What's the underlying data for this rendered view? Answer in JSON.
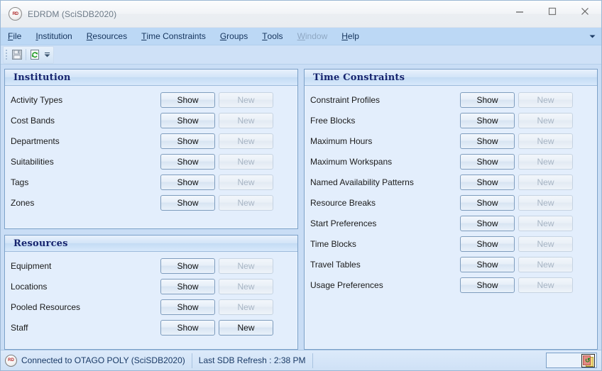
{
  "window": {
    "title": "EDRDM (SciSDB2020)",
    "app_icon": "edrdm-app-icon",
    "controls": {
      "minimize": "minimize-icon",
      "maximize": "maximize-icon",
      "close": "close-icon"
    }
  },
  "menubar": {
    "items": [
      {
        "label": "File",
        "mnemonic": "F",
        "disabled": false
      },
      {
        "label": "Institution",
        "mnemonic": "I",
        "disabled": false
      },
      {
        "label": "Resources",
        "mnemonic": "R",
        "disabled": false
      },
      {
        "label": "Time Constraints",
        "mnemonic": "T",
        "disabled": false
      },
      {
        "label": "Groups",
        "mnemonic": "G",
        "disabled": false
      },
      {
        "label": "Tools",
        "mnemonic": "T",
        "disabled": false
      },
      {
        "label": "Window",
        "mnemonic": "W",
        "disabled": true
      },
      {
        "label": "Help",
        "mnemonic": "H",
        "disabled": false
      }
    ],
    "overflow_icon": "chevron-down-icon"
  },
  "toolbar": {
    "buttons": [
      {
        "name": "save-button",
        "icon": "save-floppy-icon"
      },
      {
        "name": "refresh-button",
        "icon": "refresh-page-icon"
      }
    ],
    "overflow_icon": "toolbar-overflow-icon"
  },
  "panels": [
    {
      "id": "institution",
      "title": "Institution",
      "rows": [
        {
          "label": "Activity Types",
          "show": "Show",
          "new": "New",
          "new_enabled": false
        },
        {
          "label": "Cost Bands",
          "show": "Show",
          "new": "New",
          "new_enabled": false
        },
        {
          "label": "Departments",
          "show": "Show",
          "new": "New",
          "new_enabled": false
        },
        {
          "label": "Suitabilities",
          "show": "Show",
          "new": "New",
          "new_enabled": false
        },
        {
          "label": "Tags",
          "show": "Show",
          "new": "New",
          "new_enabled": false
        },
        {
          "label": "Zones",
          "show": "Show",
          "new": "New",
          "new_enabled": false
        }
      ]
    },
    {
      "id": "resources",
      "title": "Resources",
      "rows": [
        {
          "label": "Equipment",
          "show": "Show",
          "new": "New",
          "new_enabled": false
        },
        {
          "label": "Locations",
          "show": "Show",
          "new": "New",
          "new_enabled": false
        },
        {
          "label": "Pooled Resources",
          "show": "Show",
          "new": "New",
          "new_enabled": false
        },
        {
          "label": "Staff",
          "show": "Show",
          "new": "New",
          "new_enabled": true
        }
      ]
    },
    {
      "id": "time-constraints",
      "title": "Time Constraints",
      "rows": [
        {
          "label": "Constraint Profiles",
          "show": "Show",
          "new": "New",
          "new_enabled": false
        },
        {
          "label": "Free Blocks",
          "show": "Show",
          "new": "New",
          "new_enabled": false
        },
        {
          "label": "Maximum Hours",
          "show": "Show",
          "new": "New",
          "new_enabled": false
        },
        {
          "label": "Maximum Workspans",
          "show": "Show",
          "new": "New",
          "new_enabled": false
        },
        {
          "label": "Named Availability Patterns",
          "show": "Show",
          "new": "New",
          "new_enabled": false
        },
        {
          "label": "Resource Breaks",
          "show": "Show",
          "new": "New",
          "new_enabled": false
        },
        {
          "label": "Start Preferences",
          "show": "Show",
          "new": "New",
          "new_enabled": false
        },
        {
          "label": "Time Blocks",
          "show": "Show",
          "new": "New",
          "new_enabled": false
        },
        {
          "label": "Travel Tables",
          "show": "Show",
          "new": "New",
          "new_enabled": false
        },
        {
          "label": "Usage Preferences",
          "show": "Show",
          "new": "New",
          "new_enabled": false
        }
      ]
    }
  ],
  "statusbar": {
    "connection_icon": "edrdm-status-icon",
    "connection": "Connected to OTAGO POLY (SciSDB2020)",
    "last_refresh": "Last SDB Refresh : 2:38 PM",
    "sync_icon": "sync-refresh-icon"
  },
  "colors": {
    "window_background": "#c9ddf5",
    "panel_background": "#e3eefc",
    "panel_border": "#7ba0c8",
    "panel_title": "#16246e",
    "menubar": "#bcd8f5",
    "status_text": "#1a3a66",
    "button_border": "#7e9cbd",
    "button_disabled_text": "#a8b5c4"
  }
}
